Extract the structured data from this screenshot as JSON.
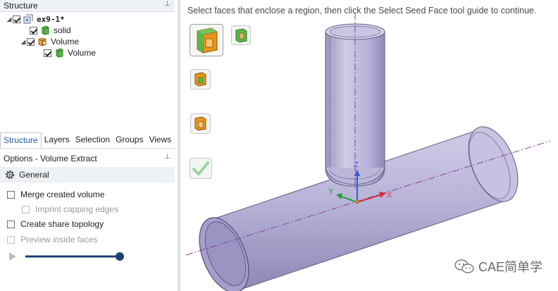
{
  "structure_panel": {
    "title": "Structure",
    "pin_glyph": "⊥",
    "tree": [
      {
        "label": "ex9-1*",
        "level": 0,
        "expanded": true,
        "checked": true,
        "icon": "design-icon"
      },
      {
        "label": "solid",
        "level": 1,
        "checked": true,
        "icon": "solid-body-icon"
      },
      {
        "label": "Volume",
        "level": 1,
        "expanded": true,
        "checked": true,
        "icon": "volume-group-icon"
      },
      {
        "label": "Volume",
        "level": 2,
        "checked": true,
        "icon": "volume-body-icon"
      }
    ]
  },
  "tabs": [
    "Structure",
    "Layers",
    "Selection",
    "Groups",
    "Views"
  ],
  "active_tab": "Structure",
  "options_panel": {
    "title": "Options - Volume Extract",
    "section": "General",
    "options": [
      {
        "label": "Merge created volume",
        "checked": false,
        "enabled": true
      },
      {
        "label": "Imprint capping edges",
        "checked": false,
        "enabled": false
      },
      {
        "label": "Create share topology",
        "checked": false,
        "enabled": true
      },
      {
        "label": "Preview inside faces",
        "checked": false,
        "enabled": false
      }
    ],
    "slider_value": 1.0
  },
  "viewport": {
    "hint": "Select faces that enclose a region, then click the Select Seed Face tool guide to continue.",
    "axes": {
      "x": "X",
      "y": "Y",
      "z": "Z"
    },
    "tool_guides": [
      "select-faces-tool-icon",
      "select-seed-face-tool-icon",
      "select-extra-face-tool-icon",
      "select-cap-face-tool-icon",
      "complete-checkmark-icon"
    ],
    "colors": {
      "body": "#b9b4d6",
      "axis_x": "#d0323a",
      "axis_y": "#2c9a3c",
      "axis_z": "#2f5fd0",
      "centerline": "#8a3fa0"
    }
  },
  "watermark": "CAE简单学"
}
